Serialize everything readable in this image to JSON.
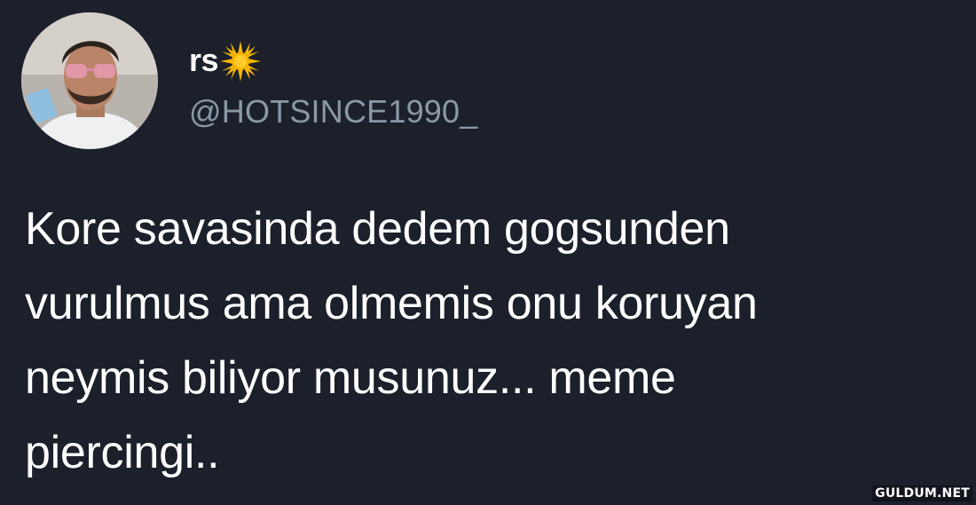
{
  "tweet": {
    "display_name": "rs",
    "name_emoji_icon": "sun-icon",
    "handle": "@HOTSINCE1990_",
    "text": "Kore savasinda dedem gogsunden\nvurulmus ama olmemis onu koruyan\nneymis biliyor musunuz... meme\npiercingi.."
  },
  "watermark": {
    "text": "GULDUM.NET"
  },
  "colors": {
    "background": "#1b202b",
    "text": "#ffffff",
    "handle": "#8b98a5",
    "sun_emoji": "#f7b500"
  }
}
